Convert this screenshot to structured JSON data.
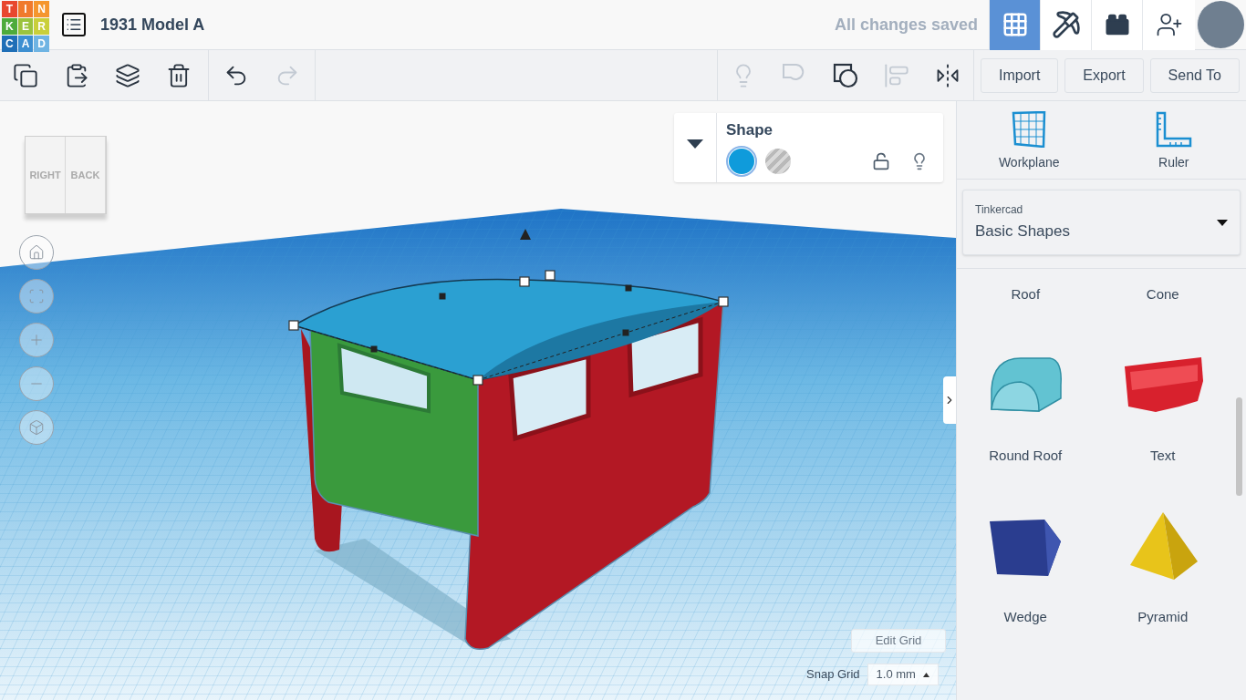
{
  "logo": {
    "letters": [
      {
        "text": "T",
        "color": "#e8472f"
      },
      {
        "text": "I",
        "color": "#f07a2c"
      },
      {
        "text": "N",
        "color": "#f5962e"
      },
      {
        "text": "K",
        "color": "#4eab3b"
      },
      {
        "text": "E",
        "color": "#9bc33d"
      },
      {
        "text": "R",
        "color": "#c9cf3a"
      },
      {
        "text": "C",
        "color": "#1f6fb7"
      },
      {
        "text": "A",
        "color": "#3d8fd1"
      },
      {
        "text": "D",
        "color": "#6fb4e3"
      }
    ]
  },
  "project_title": "1931 Model A",
  "save_status": "All changes saved",
  "view_modes": [
    {
      "kind": "grid",
      "selected": true
    },
    {
      "kind": "pickaxe",
      "selected": false
    },
    {
      "kind": "bricks",
      "selected": false
    }
  ],
  "toolbar": {
    "edit_tools": [
      {
        "kind": "copy",
        "disabled": false
      },
      {
        "kind": "paste",
        "disabled": false
      },
      {
        "kind": "duplicate",
        "disabled": false
      },
      {
        "kind": "delete",
        "disabled": false
      }
    ],
    "history_tools": [
      {
        "kind": "undo",
        "disabled": false
      },
      {
        "kind": "redo",
        "disabled": true
      }
    ],
    "shape_tools": [
      {
        "kind": "hide",
        "disabled": true
      },
      {
        "kind": "ungroup",
        "disabled": true
      },
      {
        "kind": "group",
        "disabled": false
      },
      {
        "kind": "align",
        "disabled": true
      },
      {
        "kind": "mirror",
        "disabled": false
      }
    ],
    "buttons": [
      "Import",
      "Export",
      "Send To"
    ]
  },
  "view_cube": {
    "faces": [
      "RIGHT",
      "BACK"
    ]
  },
  "shape_panel": {
    "title": "Shape",
    "options": [
      {
        "kind": "solid",
        "selected": true
      },
      {
        "kind": "hole",
        "selected": false
      }
    ],
    "locked": false
  },
  "side_tools": [
    {
      "kind": "workplane",
      "label": "Workplane"
    },
    {
      "kind": "ruler",
      "label": "Ruler"
    }
  ],
  "library": {
    "source": "Tinkercad",
    "selection": "Basic Shapes"
  },
  "shapes": [
    {
      "kind": "roof",
      "label": "Roof"
    },
    {
      "kind": "cone",
      "label": "Cone"
    },
    {
      "kind": "round-roof",
      "label": "Round Roof"
    },
    {
      "kind": "text",
      "label": "Text"
    },
    {
      "kind": "wedge",
      "label": "Wedge"
    },
    {
      "kind": "pyramid",
      "label": "Pyramid"
    }
  ],
  "grid": {
    "edit_label": "Edit Grid",
    "snap_label": "Snap Grid",
    "snap_value": "1.0 mm"
  }
}
